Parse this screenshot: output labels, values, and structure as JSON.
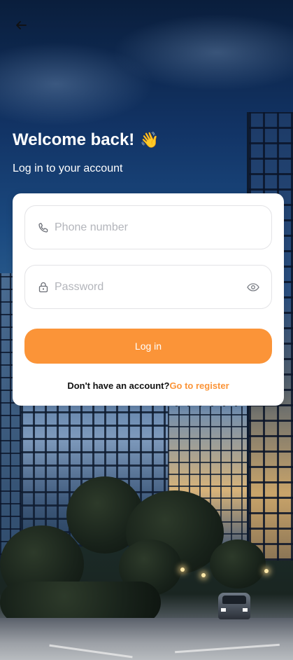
{
  "header": {
    "back_icon": "arrow-left-icon",
    "title": "Welcome back!",
    "title_emoji": "👋",
    "subtitle": "Log in to your account"
  },
  "form": {
    "phone_placeholder": "Phone number",
    "phone_icon": "phone-icon",
    "password_placeholder": "Password",
    "password_icon": "lock-icon",
    "toggle_visibility_icon": "eye-icon",
    "login_label": "Log in",
    "register_prompt": "Don't have an account?",
    "register_link": "Go to register"
  },
  "colors": {
    "accent": "#fb9438",
    "card_bg": "#ffffff",
    "placeholder": "#b3b5bb"
  }
}
